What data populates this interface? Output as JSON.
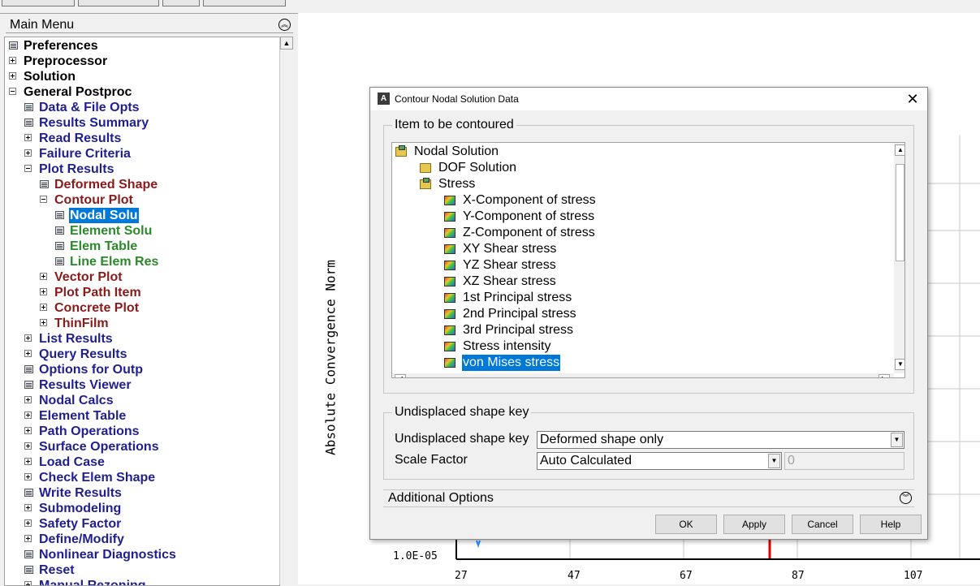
{
  "main_menu": {
    "title": "Main Menu",
    "items": [
      {
        "label": "Preferences",
        "indent": 0,
        "glyph": "doc",
        "color": "black"
      },
      {
        "label": "Preprocessor",
        "indent": 0,
        "glyph": "plus",
        "color": "black"
      },
      {
        "label": "Solution",
        "indent": 0,
        "glyph": "plus",
        "color": "black"
      },
      {
        "label": "General Postproc",
        "indent": 0,
        "glyph": "minus",
        "color": "black"
      },
      {
        "label": "Data & File Opts",
        "indent": 1,
        "glyph": "doc",
        "color": "navy"
      },
      {
        "label": "Results Summary",
        "indent": 1,
        "glyph": "doc",
        "color": "navy"
      },
      {
        "label": "Read Results",
        "indent": 1,
        "glyph": "plus",
        "color": "navy"
      },
      {
        "label": "Failure Criteria",
        "indent": 1,
        "glyph": "plus",
        "color": "navy"
      },
      {
        "label": "Plot Results",
        "indent": 1,
        "glyph": "minus",
        "color": "navy"
      },
      {
        "label": "Deformed Shape",
        "indent": 2,
        "glyph": "doc",
        "color": "maroon"
      },
      {
        "label": "Contour Plot",
        "indent": 2,
        "glyph": "minus",
        "color": "maroon"
      },
      {
        "label": "Nodal Solu",
        "indent": 3,
        "glyph": "doc",
        "color": "selected"
      },
      {
        "label": "Element Solu",
        "indent": 3,
        "glyph": "doc",
        "color": "green"
      },
      {
        "label": "Elem Table",
        "indent": 3,
        "glyph": "doc",
        "color": "green"
      },
      {
        "label": "Line Elem Res",
        "indent": 3,
        "glyph": "doc",
        "color": "green"
      },
      {
        "label": "Vector Plot",
        "indent": 2,
        "glyph": "plus",
        "color": "maroon"
      },
      {
        "label": "Plot Path Item",
        "indent": 2,
        "glyph": "plus",
        "color": "maroon"
      },
      {
        "label": "Concrete Plot",
        "indent": 2,
        "glyph": "plus",
        "color": "maroon"
      },
      {
        "label": "ThinFilm",
        "indent": 2,
        "glyph": "plus",
        "color": "maroon"
      },
      {
        "label": "List Results",
        "indent": 1,
        "glyph": "plus",
        "color": "navy"
      },
      {
        "label": "Query Results",
        "indent": 1,
        "glyph": "plus",
        "color": "navy"
      },
      {
        "label": "Options for Outp",
        "indent": 1,
        "glyph": "doc",
        "color": "navy"
      },
      {
        "label": "Results Viewer",
        "indent": 1,
        "glyph": "doc",
        "color": "navy"
      },
      {
        "label": "Nodal Calcs",
        "indent": 1,
        "glyph": "plus",
        "color": "navy"
      },
      {
        "label": "Element Table",
        "indent": 1,
        "glyph": "plus",
        "color": "navy"
      },
      {
        "label": "Path Operations",
        "indent": 1,
        "glyph": "plus",
        "color": "navy"
      },
      {
        "label": "Surface Operations",
        "indent": 1,
        "glyph": "plus",
        "color": "navy"
      },
      {
        "label": "Load Case",
        "indent": 1,
        "glyph": "plus",
        "color": "navy"
      },
      {
        "label": "Check Elem Shape",
        "indent": 1,
        "glyph": "plus",
        "color": "navy"
      },
      {
        "label": "Write Results",
        "indent": 1,
        "glyph": "doc",
        "color": "navy"
      },
      {
        "label": "Submodeling",
        "indent": 1,
        "glyph": "plus",
        "color": "navy"
      },
      {
        "label": "Safety Factor",
        "indent": 1,
        "glyph": "plus",
        "color": "navy"
      },
      {
        "label": "Define/Modify",
        "indent": 1,
        "glyph": "plus",
        "color": "navy"
      },
      {
        "label": "Nonlinear Diagnostics",
        "indent": 1,
        "glyph": "doc",
        "color": "navy"
      },
      {
        "label": "Reset",
        "indent": 1,
        "glyph": "doc",
        "color": "navy"
      },
      {
        "label": "Manual Rezoning",
        "indent": 1,
        "glyph": "plus",
        "color": "navy"
      }
    ]
  },
  "plot": {
    "ylabel": "Absolute Convergence Norm",
    "ytick": "1.0E-05",
    "xticks": [
      "27",
      "47",
      "67",
      "87",
      "107"
    ]
  },
  "dialog": {
    "title": "Contour Nodal Solution Data",
    "logo": "A",
    "item_group_label": "Item to be contoured",
    "items": [
      {
        "label": "Nodal Solution",
        "indent": 0,
        "icon": "folder-open"
      },
      {
        "label": "DOF Solution",
        "indent": 1,
        "icon": "folder-closed"
      },
      {
        "label": "Stress",
        "indent": 1,
        "icon": "folder-open"
      },
      {
        "label": "X-Component of stress",
        "indent": 2,
        "icon": "cube"
      },
      {
        "label": "Y-Component of stress",
        "indent": 2,
        "icon": "cube"
      },
      {
        "label": "Z-Component of stress",
        "indent": 2,
        "icon": "cube"
      },
      {
        "label": "XY Shear stress",
        "indent": 2,
        "icon": "cube"
      },
      {
        "label": "YZ Shear stress",
        "indent": 2,
        "icon": "cube"
      },
      {
        "label": "XZ Shear stress",
        "indent": 2,
        "icon": "cube"
      },
      {
        "label": "1st Principal stress",
        "indent": 2,
        "icon": "cube"
      },
      {
        "label": "2nd Principal stress",
        "indent": 2,
        "icon": "cube"
      },
      {
        "label": "3rd Principal stress",
        "indent": 2,
        "icon": "cube"
      },
      {
        "label": "Stress intensity",
        "indent": 2,
        "icon": "cube"
      },
      {
        "label": "von Mises stress",
        "indent": 2,
        "icon": "cube",
        "selected": true
      }
    ],
    "undisplaced_group_label": "Undisplaced shape key",
    "undisplaced_label": "Undisplaced shape key",
    "undisplaced_value": "Deformed shape only",
    "scale_label": "Scale Factor",
    "scale_value": "Auto Calculated",
    "scale_text": "0",
    "additional_options": "Additional Options",
    "buttons": {
      "ok": "OK",
      "apply": "Apply",
      "cancel": "Cancel",
      "help": "Help"
    }
  },
  "colors": {
    "selection": "#0078d7",
    "navy": "#1f1f8f",
    "maroon": "#8b1a1a",
    "green": "#2a8a2a",
    "marker_red": "#e00000",
    "marker_blue": "#1e90ff"
  }
}
